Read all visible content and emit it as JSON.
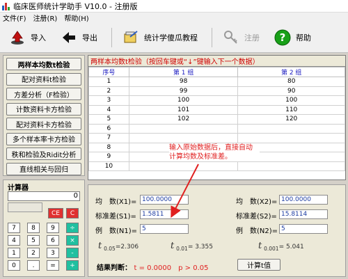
{
  "window": {
    "title": "临床医师统计学助手 V10.0 - 注册版"
  },
  "menu": [
    "文件(F)",
    "注册(R)",
    "帮助(H)"
  ],
  "toolbar": {
    "import": "导入",
    "export": "导出",
    "tutorial": "统计学傻瓜教程",
    "register": "注册",
    "help": "帮助"
  },
  "tests": [
    "两样本均数t检验",
    "配对资料t检验",
    "方差分析（F检验）",
    "计数资料卡方检验",
    "配对资料卡方检验",
    "多个样本率卡方检验",
    "秩和检验及Ridit分析",
    "直线相关与回归"
  ],
  "calculator": {
    "title": "计算器",
    "display": "0",
    "ce": "CE",
    "c": "C",
    "keys": [
      "7",
      "8",
      "9",
      "÷",
      "4",
      "5",
      "6",
      "×",
      "1",
      "2",
      "3",
      "-",
      "0",
      ".",
      "=",
      "+"
    ]
  },
  "grid": {
    "caption": "两样本均数t检验（按回车键或“↓”键输入下一个数据）",
    "headers": [
      "序号",
      "第 1 组",
      "第 2 组"
    ],
    "rows": [
      [
        "1",
        "98",
        "80"
      ],
      [
        "2",
        "99",
        "90"
      ],
      [
        "3",
        "100",
        "100"
      ],
      [
        "4",
        "101",
        "110"
      ],
      [
        "5",
        "102",
        "120"
      ],
      [
        "6",
        "",
        ""
      ],
      [
        "7",
        "",
        ""
      ],
      [
        "8",
        "",
        ""
      ],
      [
        "9",
        "",
        ""
      ],
      [
        "10",
        "",
        ""
      ]
    ]
  },
  "annotation": {
    "line1": "输入原始数据后，直接自动",
    "line2": "计算均数及标准差。"
  },
  "stats": {
    "mean_label_1": "均　数(X1)=",
    "mean_value_1": "100.0000",
    "sd_label_1": "标准差(S1)=",
    "sd_value_1": "1.5811",
    "n_label_1": "例　数(N1)=",
    "n_value_1": "5",
    "mean_label_2": "均　数(X2)=",
    "mean_value_2": "100.0000",
    "sd_label_2": "标准差(S2)=",
    "sd_value_2": "15.8114",
    "n_label_2": "例　数(N2)=",
    "n_value_2": "5",
    "t_symbol": "t",
    "t005_sub": "0.05",
    "t005_val": "=2.306",
    "t001_sub": "0.01",
    "t001_val": "= 3.355",
    "t0001_sub": "0.001",
    "t0001_val": "= 5.041",
    "result_label": "结果判断：",
    "result_value": "t = 0.0000　p > 0.05",
    "calc_button": "计算t值"
  }
}
